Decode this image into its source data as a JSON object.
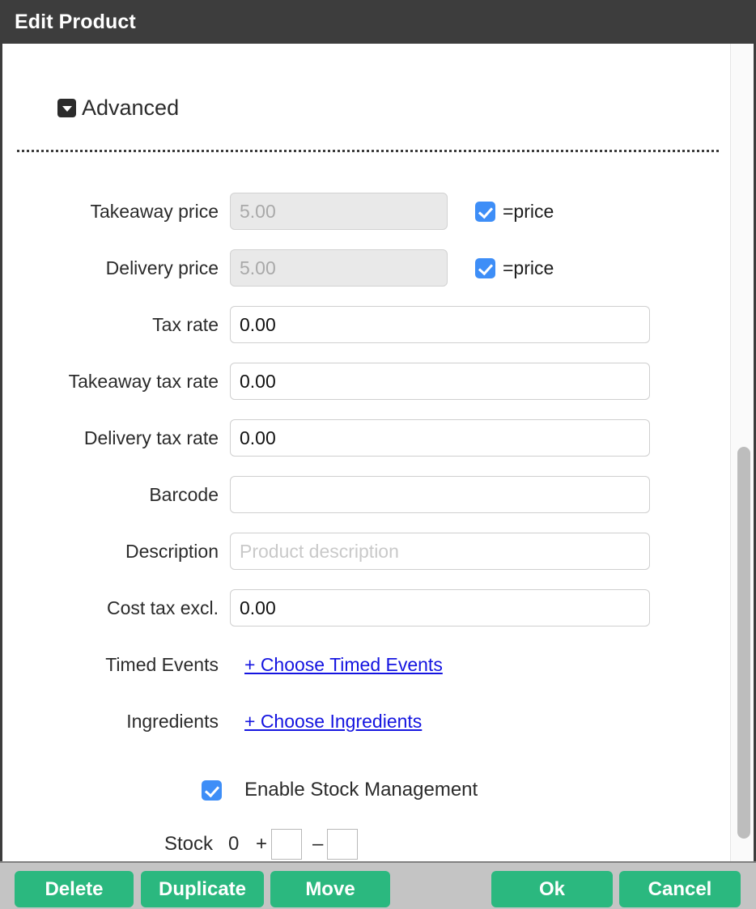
{
  "window": {
    "title": "Edit Product"
  },
  "section": {
    "toggle_icon": "caret-down-icon",
    "label": "Advanced"
  },
  "fields": {
    "takeaway_price": {
      "label": "Takeaway price",
      "value": "5.00",
      "disabled": true,
      "checkbox_label": "=price",
      "checkbox_checked": true
    },
    "delivery_price": {
      "label": "Delivery price",
      "value": "5.00",
      "disabled": true,
      "checkbox_label": "=price",
      "checkbox_checked": true
    },
    "tax_rate": {
      "label": "Tax rate",
      "value": "0.00"
    },
    "takeaway_tax_rate": {
      "label": "Takeaway tax rate",
      "value": "0.00"
    },
    "delivery_tax_rate": {
      "label": "Delivery tax rate",
      "value": "0.00"
    },
    "barcode": {
      "label": "Barcode",
      "value": ""
    },
    "description": {
      "label": "Description",
      "value": "",
      "placeholder": "Product description"
    },
    "cost_tax_excl": {
      "label": "Cost tax excl.",
      "value": "0.00"
    },
    "timed_events": {
      "label": "Timed Events",
      "link": "+ Choose Timed Events"
    },
    "ingredients": {
      "label": "Ingredients",
      "link": "+ Choose Ingredients"
    }
  },
  "stock": {
    "enable_label": "Enable Stock Management",
    "enable_checked": true,
    "label": "Stock",
    "current": "0",
    "plus_sign": "+",
    "minus_sign": "–",
    "add_value": "",
    "subtract_value": ""
  },
  "footer": {
    "delete_label": "Delete",
    "duplicate_label": "Duplicate",
    "move_label": "Move",
    "ok_label": "Ok",
    "cancel_label": "Cancel"
  },
  "colors": {
    "titlebar": "#3d3d3d",
    "checkbox_blue": "#3e8ef7",
    "button_green": "#2bb87f",
    "footer_gray": "#c4c4c4",
    "link_blue": "#1414e0"
  }
}
